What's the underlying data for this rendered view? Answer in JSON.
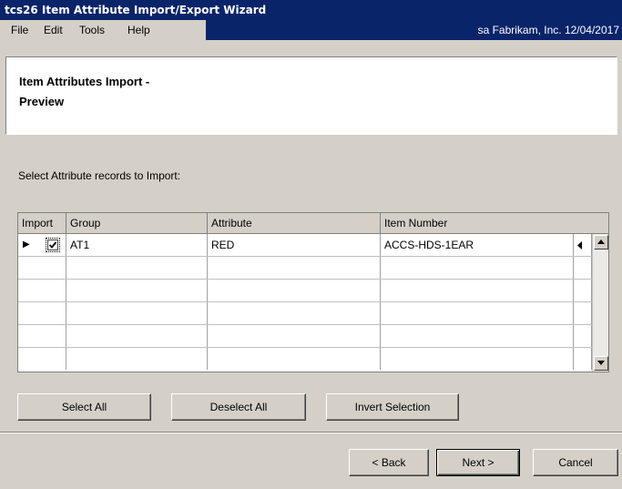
{
  "window": {
    "title": "tcs26 Item Attribute Import/Export Wizard"
  },
  "menu": {
    "items": [
      "File",
      "Edit",
      "Tools",
      "Help"
    ],
    "status": "sa  Fabrikam, Inc.  12/04/2017"
  },
  "header": {
    "title_line1": "Item Attributes Import -",
    "title_line2": "Preview"
  },
  "instructions": "Select Attribute records to Import:",
  "grid": {
    "columns": [
      "Import",
      "Group",
      "Attribute",
      "Item Number"
    ],
    "rows": [
      {
        "import": true,
        "group": "AT1",
        "attribute": "RED",
        "item_number": "ACCS-HDS-1EAR"
      }
    ]
  },
  "buttons": {
    "select_all": "Select All",
    "deselect_all": "Deselect All",
    "invert_selection": "Invert Selection",
    "back": "< Back",
    "next": "Next >",
    "cancel": "Cancel"
  },
  "icons": {
    "row_indicator": "row-pointer-icon",
    "scroll_up": "arrow-up-icon",
    "scroll_down": "arrow-down-icon",
    "scroll_left": "arrow-left-icon"
  },
  "colors": {
    "titlebar": "#0a246a",
    "face": "#d4d0c8"
  }
}
